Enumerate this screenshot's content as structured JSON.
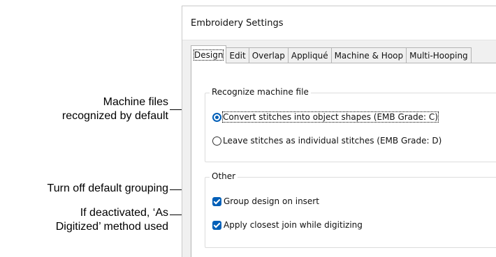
{
  "callouts": {
    "machine_files": [
      "Machine files",
      "recognized by default"
    ],
    "grouping": "Turn off default grouping",
    "as_digitized": [
      "If deactivated, ‘As",
      "Digitized’ method used"
    ]
  },
  "dialog": {
    "title": "Embroidery Settings",
    "tabs": [
      "Design",
      "Edit",
      "Overlap",
      "Appliqué",
      "Machine & Hoop",
      "Multi-Hooping"
    ],
    "active_tab": "Design",
    "recognize_group": {
      "label": "Recognize machine file",
      "options": [
        {
          "label": "Convert stitches into object shapes (EMB Grade: C)",
          "selected": true
        },
        {
          "label": "Leave stitches as individual stitches (EMB Grade: D)",
          "selected": false
        }
      ]
    },
    "other_group": {
      "label": "Other",
      "checkboxes": [
        {
          "label": "Group design on insert",
          "checked": true
        },
        {
          "label": "Apply closest join while digitizing",
          "checked": true
        }
      ]
    }
  },
  "colors": {
    "accent": "#005fb8",
    "dialog_bg": "#f0f0f0"
  }
}
